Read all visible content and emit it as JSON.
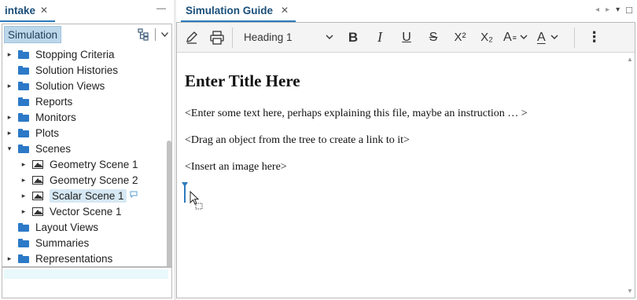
{
  "left": {
    "tab_title": "intake",
    "tab_close": "✕",
    "minimize_glyph": "—",
    "tree_root": "Simulation",
    "items": [
      {
        "label": "Stopping Criteria",
        "indent": 0,
        "twisty": "▸",
        "icon": "folder-icon"
      },
      {
        "label": "Solution Histories",
        "indent": 0,
        "twisty": "",
        "icon": "folder-icon"
      },
      {
        "label": "Solution Views",
        "indent": 0,
        "twisty": "▸",
        "icon": "folder-icon"
      },
      {
        "label": "Reports",
        "indent": 0,
        "twisty": "",
        "icon": "folder-icon"
      },
      {
        "label": "Monitors",
        "indent": 0,
        "twisty": "▸",
        "icon": "folder-icon"
      },
      {
        "label": "Plots",
        "indent": 0,
        "twisty": "▸",
        "icon": "folder-icon"
      },
      {
        "label": "Scenes",
        "indent": 0,
        "twisty": "▾",
        "icon": "folder-icon"
      },
      {
        "label": "Geometry Scene 1",
        "indent": 1,
        "twisty": "▸",
        "icon": "scene-icon"
      },
      {
        "label": "Geometry Scene 2",
        "indent": 1,
        "twisty": "▸",
        "icon": "scene-icon"
      },
      {
        "label": "Scalar Scene 1",
        "indent": 1,
        "twisty": "▸",
        "icon": "scene-icon",
        "selected": true
      },
      {
        "label": "Vector Scene 1",
        "indent": 1,
        "twisty": "▸",
        "icon": "scene-icon"
      },
      {
        "label": "Layout Views",
        "indent": 0,
        "twisty": "",
        "icon": "folder-icon"
      },
      {
        "label": "Summaries",
        "indent": 0,
        "twisty": "",
        "icon": "folder-icon"
      },
      {
        "label": "Representations",
        "indent": 0,
        "twisty": "▸",
        "icon": "folder-icon"
      }
    ]
  },
  "right": {
    "tab_title": "Simulation Guide",
    "tab_close": "✕",
    "window_controls": [
      "◂",
      "▸",
      "▾",
      "□"
    ],
    "toolbar": {
      "style_value": "Heading 1",
      "bold": "B",
      "italic": "I",
      "underline": "U",
      "strike": "S",
      "superscript": "X²",
      "subscript": "X₂",
      "font_size": "A",
      "font_color": "A",
      "more": "⋮"
    },
    "document": {
      "title": "Enter Title Here",
      "paragraphs": [
        "<Enter some text here, perhaps explaining this file, maybe an instruction … >",
        "<Drag an object from the tree to create a link to it>",
        "<Insert an image here>"
      ]
    }
  },
  "colors": {
    "accent": "#2b7bbd",
    "tab_text": "#1a4f7a",
    "folder": "#2c79c7",
    "selection": "#d6e8f4",
    "header_bg": "#bcd7ea"
  }
}
